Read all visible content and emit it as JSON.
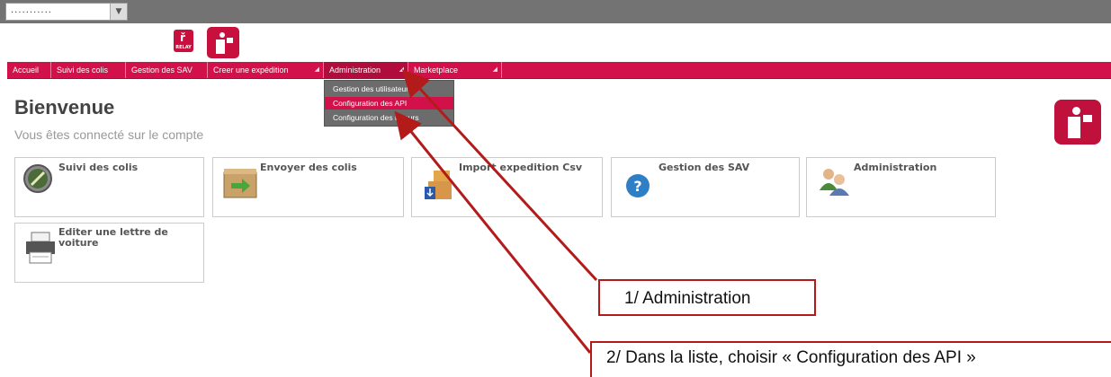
{
  "topbar": {
    "select_value": "..........."
  },
  "logos": {
    "small_logo_text": "RELAY"
  },
  "nav": {
    "items": [
      {
        "label": "Accueil"
      },
      {
        "label": "Suivi des colis"
      },
      {
        "label": "Gestion des SAV"
      },
      {
        "label": "Creer une expédition"
      },
      {
        "label": "Administration"
      },
      {
        "label": "Marketplace"
      }
    ]
  },
  "dropdown": {
    "items": [
      {
        "label": "Gestion des utilisateurs"
      },
      {
        "label": "Configuration des API"
      },
      {
        "label": "Configuration des retours"
      }
    ],
    "selected_index": 1
  },
  "page": {
    "title": "Bienvenue",
    "subtitle": "Vous êtes connecté sur le compte"
  },
  "tiles": [
    {
      "label": "Suivi des colis",
      "icon": "compass-icon"
    },
    {
      "label": "Envoyer des colis",
      "icon": "box-arrow-icon"
    },
    {
      "label": "Import expedition Csv",
      "icon": "import-boxes-icon"
    },
    {
      "label": "Gestion des SAV",
      "icon": "help-icon"
    },
    {
      "label": "Administration",
      "icon": "users-icon"
    },
    {
      "label": "Editer une lettre de voiture",
      "icon": "printer-icon"
    }
  ],
  "annotations": {
    "step1": "1/ Administration",
    "step2": "2/ Dans la liste, choisir « Configuration des API »",
    "arrow_color": "#b31b1b"
  },
  "colors": {
    "brand": "#d2104a",
    "topbar": "#737373",
    "dropdown": "#6c6c6c"
  }
}
